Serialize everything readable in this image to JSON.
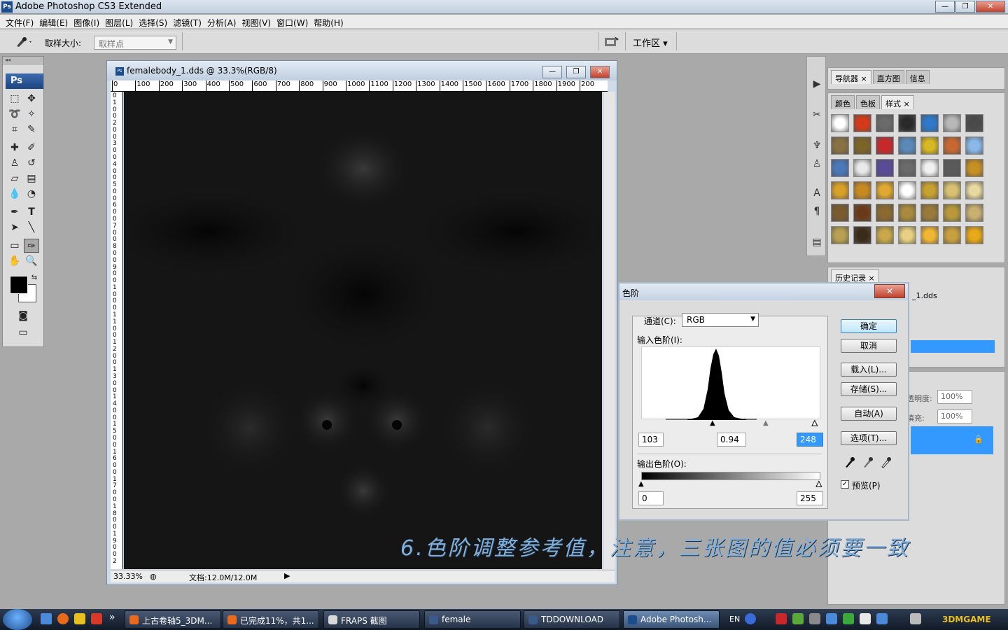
{
  "app": {
    "title": "Adobe Photoshop CS3 Extended",
    "ps_badge": "Ps"
  },
  "window_controls": {
    "minimize": "—",
    "restore": "❐",
    "close": "✕"
  },
  "menu": [
    "文件(F)",
    "编辑(E)",
    "图像(I)",
    "图层(L)",
    "选择(S)",
    "滤镜(T)",
    "分析(A)",
    "视图(V)",
    "窗口(W)",
    "帮助(H)"
  ],
  "options_bar": {
    "sample_size_label": "取样大小:",
    "sample_size_value": "取样点",
    "workspace_label": "工作区 ▾"
  },
  "toolbox": {
    "logo": "Ps",
    "collapse": "◂◂"
  },
  "document": {
    "title": "femalebody_1.dds @ 33.3%(RGB/8)",
    "ruler_h": [
      "0",
      "100",
      "200",
      "300",
      "400",
      "500",
      "600",
      "700",
      "800",
      "900",
      "1000",
      "1100",
      "1200",
      "1300",
      "1400",
      "1500",
      "1600",
      "1700",
      "1800",
      "1900",
      "200"
    ],
    "ruler_v": [
      "0",
      "1",
      "0",
      "0",
      "2",
      "0",
      "0",
      "3",
      "0",
      "0",
      "4",
      "0",
      "0",
      "5",
      "0",
      "0",
      "6",
      "0",
      "0",
      "7",
      "0",
      "0",
      "8",
      "0",
      "0",
      "9",
      "0",
      "0",
      "1",
      "0",
      "0",
      "0",
      "1",
      "1",
      "0",
      "0",
      "1",
      "2",
      "0",
      "0",
      "1",
      "3",
      "0",
      "0",
      "1",
      "4",
      "0",
      "0",
      "1",
      "5",
      "0",
      "0",
      "1",
      "6",
      "0",
      "0",
      "1",
      "7",
      "0",
      "0",
      "1",
      "8",
      "0",
      "0",
      "1",
      "9",
      "0",
      "0",
      "2"
    ],
    "zoom": "33.33%",
    "doc_size": "文档:12.0M/12.0M"
  },
  "panels": {
    "navigator_tabs": [
      "导航器 ×",
      "直方图",
      "信息"
    ],
    "styles_tabs": [
      "颜色",
      "色板",
      "样式 ×"
    ],
    "history_tab": "历史记录 ×",
    "history_item": "_1.dds",
    "opacity_label": "透明度:",
    "opacity_value": "100%",
    "fill_label": "填充:",
    "fill_value": "100%"
  },
  "style_colors": [
    "#ffffff",
    "#d23a1a",
    "#6a6a6a",
    "#2a2a2a",
    "#2e78c8",
    "#b8b8b8",
    "#4a4a4a",
    "#8a7240",
    "#7c6428",
    "#c8282a",
    "#5a8ab8",
    "#d8b820",
    "#c86830",
    "#8ab8e8",
    "#4a78b8",
    "#e8e8e8",
    "#5a4a9a",
    "#6a6a6a",
    "#f0f0f0",
    "#5a5a5a",
    "#c89020",
    "#d8a028",
    "#c88a20",
    "#e0a830",
    "#ffffff",
    "#c8a030",
    "#d8c070",
    "#e8d8a0",
    "#7a5a30",
    "#6a3a18",
    "#8a6a30",
    "#a88a40",
    "#9a7a38",
    "#b8983a",
    "#c8b070",
    "#b8a050",
    "#3a2a18",
    "#c8a848",
    "#e8d080",
    "#f0b830",
    "#c8a040",
    "#e8a818"
  ],
  "levels": {
    "title": "色阶",
    "close": "✕",
    "channel_label": "通道(C):",
    "channel_value": "RGB",
    "input_label": "输入色阶(I):",
    "input_black": "103",
    "input_gamma": "0.94",
    "input_white": "248",
    "output_label": "输出色阶(O):",
    "output_black": "0",
    "output_white": "255",
    "buttons": {
      "ok": "确定",
      "cancel": "取消",
      "load": "载入(L)...",
      "save": "存储(S)...",
      "auto": "自动(A)",
      "options": "选项(T)..."
    },
    "preview_label": "预览(P)",
    "preview_checked": true
  },
  "caption": "6.色阶调整参考值，注意，三张图的值必须要一致",
  "taskbar": {
    "tasks": [
      {
        "label": "上古卷轴5_3DM...",
        "icon_color": "#e86a1a"
      },
      {
        "label": "已完成11%，共1...",
        "icon_color": "#e86a1a"
      },
      {
        "label": "FRAPS 截图",
        "icon_color": "#d8d8d8"
      },
      {
        "label": "female",
        "icon_color": "#3a5a8a"
      },
      {
        "label": "TDDOWNLOAD",
        "icon_color": "#3a5a8a"
      },
      {
        "label": "Adobe Photosh...",
        "icon_color": "#1b4c8c"
      }
    ],
    "tray_lang": "EN",
    "overflow": "»",
    "watermark": "3DMGAME"
  }
}
